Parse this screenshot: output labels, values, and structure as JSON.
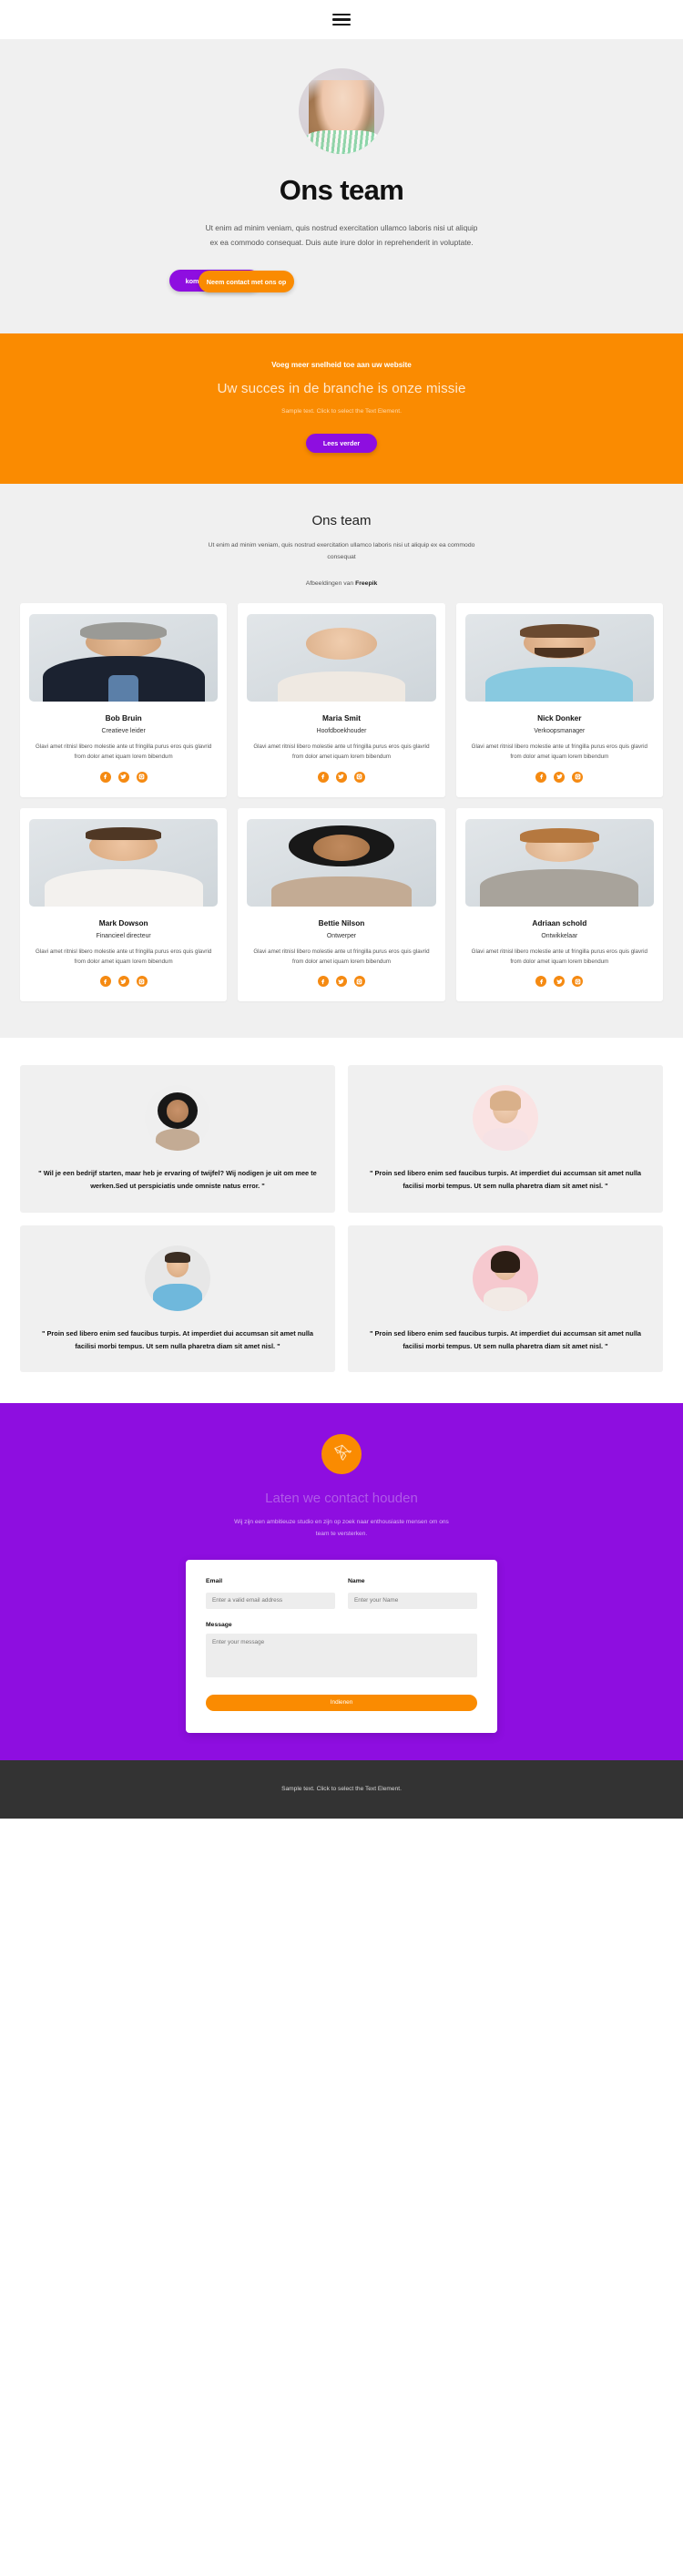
{
  "navbar": {
    "menu_icon": "hamburger-menu-icon"
  },
  "hero": {
    "title": "Ons team",
    "subtitle": "Ut enim ad minim veniam, quis nostrud exercitation ullamco laboris nisi ut aliquip ex ea commodo consequat. Duis aute irure dolor in reprehenderit in voluptate.",
    "btn_primary": "kom meer te weten",
    "btn_secondary": "Neem contact met ons op"
  },
  "cta": {
    "kicker": "Voeg meer snelheid toe aan uw website",
    "title": "Uw succes in de branche is onze missie",
    "text": "Sample text. Click to select the Text Element.",
    "button": "Lees verder"
  },
  "team": {
    "title": "Ons team",
    "subtitle": "Ut enim ad minim veniam, quis nostrud exercitation ullamco laboris nisi ut aliquip ex ea commodo consequat",
    "credit_prefix": "Afbeeldingen van ",
    "credit_link": "Freepik",
    "description": "Glavi amet ritnisl libero molestie ante ut fringilla purus eros quis glavrid from dolor amet iquam lorem bibendum",
    "members": [
      {
        "name": "Bob Bruin",
        "role": "Creatieve leider"
      },
      {
        "name": "Maria Smit",
        "role": "Hoofdboekhouder"
      },
      {
        "name": "Nick Donker",
        "role": "Verkoopsmanager"
      },
      {
        "name": "Mark Dowson",
        "role": "Financieel directeur"
      },
      {
        "name": "Bettie Nilson",
        "role": "Ontwerper"
      },
      {
        "name": "Adriaan schold",
        "role": "Ontwikkelaar"
      }
    ],
    "social_icons": [
      "facebook-icon",
      "twitter-icon",
      "instagram-icon"
    ]
  },
  "testimonials": [
    {
      "quote": "\" Wil je een bedrijf starten, maar heb je ervaring of twijfel? Wij nodigen je uit om mee te werken.Sed ut perspiciatis unde omniste natus error. \""
    },
    {
      "quote": "\" Proin sed libero enim sed faucibus turpis. At imperdiet dui accumsan sit amet nulla facilisi morbi tempus. Ut sem nulla pharetra diam sit amet nisl. \""
    },
    {
      "quote": "\" Proin sed libero enim sed faucibus turpis. At imperdiet dui accumsan sit amet nulla facilisi morbi tempus. Ut sem nulla pharetra diam sit amet nisl. \""
    },
    {
      "quote": "\" Proin sed libero enim sed faucibus turpis. At imperdiet dui accumsan sit amet nulla facilisi morbi tempus. Ut sem nulla pharetra diam sit amet nisl. \""
    }
  ],
  "contact": {
    "logo_icon": "origami-bird-icon",
    "title": "Laten we contact houden",
    "subtitle": "Wij zijn een ambitieuze studio en zijn op zoek naar enthousiaste mensen om ons team te versterken.",
    "email_label": "Email",
    "email_placeholder": "Enter a valid email address",
    "name_label": "Name",
    "name_placeholder": "Enter your Name",
    "message_label": "Message",
    "message_placeholder": "Enter your message",
    "submit_label": "Indienen"
  },
  "footer": {
    "text": "Sample text. Click to select the Text Element."
  },
  "colors": {
    "orange": "#fa8b01",
    "purple": "#8e0ee0",
    "light_gray": "#f0f0f0",
    "footer_dark": "#333333"
  }
}
